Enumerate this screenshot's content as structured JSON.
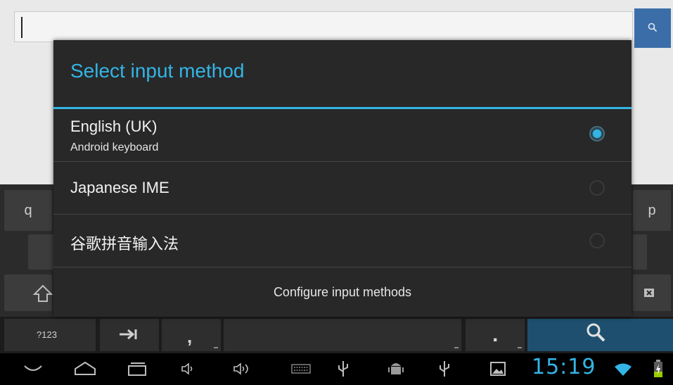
{
  "dialog": {
    "title": "Select input method",
    "items": [
      {
        "label": "English (UK)",
        "sublabel": "Android keyboard",
        "selected": true
      },
      {
        "label": "Japanese IME",
        "sublabel": "",
        "selected": false
      },
      {
        "label": "谷歌拼音输入法",
        "sublabel": "",
        "selected": false
      }
    ],
    "configure_label": "Configure input methods"
  },
  "keyboard": {
    "left_key": "q",
    "right_key": "p",
    "symbols_key": "?123",
    "comma_key": ",",
    "period_key": "."
  },
  "status": {
    "clock": "15:19"
  },
  "colors": {
    "accent": "#33b5e5",
    "dialog_bg": "#282828",
    "search_button": "#3b6ea8"
  },
  "icons": {
    "search": "search-icon",
    "back": "back-icon",
    "home": "home-icon",
    "recents": "recent-apps-icon",
    "volume_down": "volume-down-icon",
    "volume_up": "volume-up-icon",
    "keyboard": "keyboard-icon",
    "usb": "usb-icon",
    "android_debug": "android-debug-icon",
    "gallery": "image-icon",
    "wifi": "wifi-icon",
    "battery": "battery-charging-icon"
  }
}
